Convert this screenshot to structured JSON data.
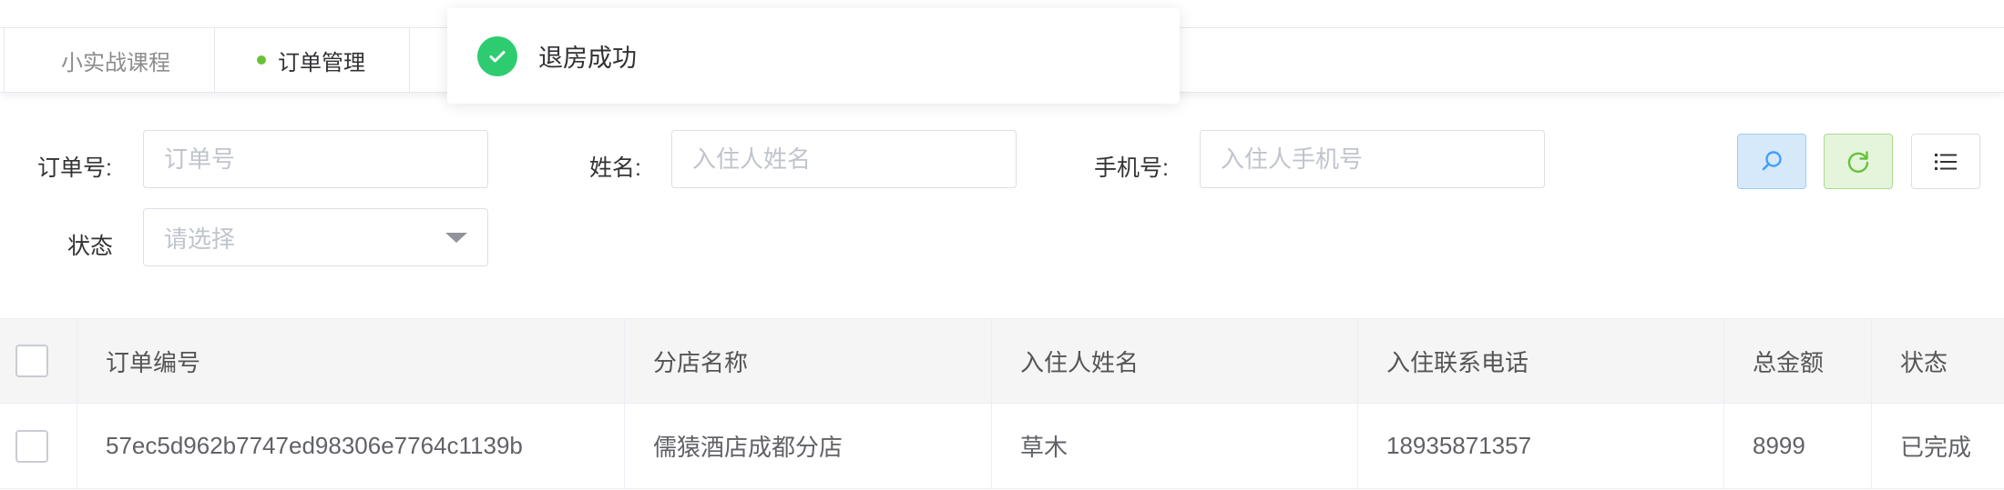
{
  "tabs": [
    {
      "label": "小实战课程",
      "active": false
    },
    {
      "label": "订单管理",
      "active": true
    }
  ],
  "toast": {
    "message": "退房成功",
    "type": "success"
  },
  "filters": {
    "order_no": {
      "label": "订单号:",
      "placeholder": "订单号"
    },
    "name": {
      "label": "姓名:",
      "placeholder": "入住人姓名"
    },
    "phone": {
      "label": "手机号:",
      "placeholder": "入住人手机号"
    },
    "status": {
      "label": "状态",
      "placeholder": "请选择"
    }
  },
  "toolbar": {
    "search_icon": "search-icon",
    "refresh_icon": "refresh-icon",
    "columns_icon": "list-icon"
  },
  "table": {
    "headers": [
      "订单编号",
      "分店名称",
      "入住人姓名",
      "入住联系电话",
      "总金额",
      "状态"
    ],
    "rows": [
      [
        "57ec5d962b7747ed98306e7764c1139b",
        "儒猿酒店成都分店",
        "草木",
        "18935871357",
        "8999",
        "已完成"
      ]
    ]
  },
  "colors": {
    "success": "#2ecc71",
    "primary": "#409eff",
    "refresh": "#67c23a"
  }
}
